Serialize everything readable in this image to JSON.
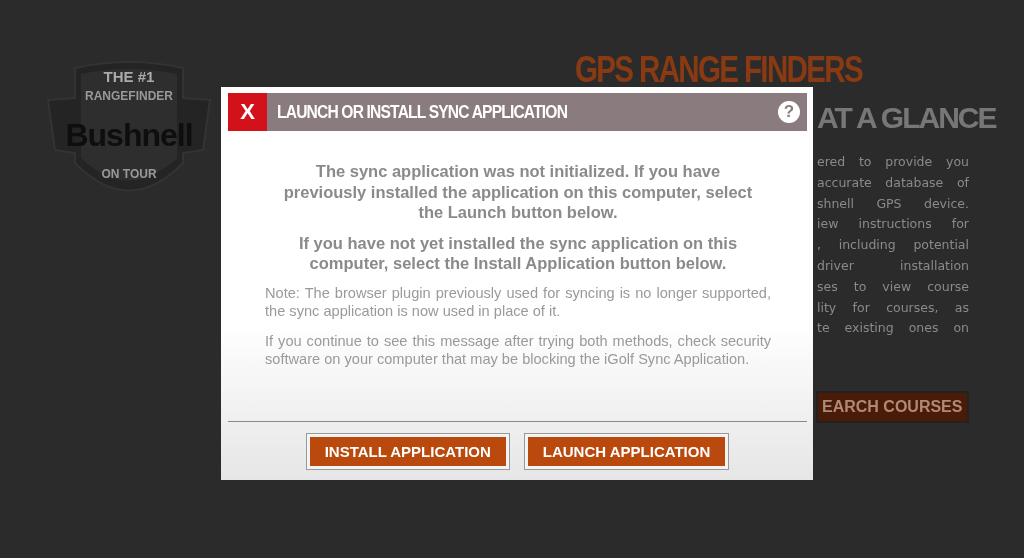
{
  "background_page": {
    "logo": {
      "top_text": "THE #1",
      "arc_text": "RANGEFINDER",
      "brand": "Bushnell",
      "bottom_text": "ON TOUR"
    },
    "heading": "GPS RANGE FINDERS",
    "subheading": "AT A GLANCE",
    "paragraph_lines": [
      "ered to provide you",
      "accurate database of",
      "shnell GPS device.",
      "iew instructions for",
      ", including potential",
      "driver installation",
      "ses to view course",
      "lity for courses, as",
      "te existing ones on"
    ],
    "search_button": "EARCH COURSES"
  },
  "dialog": {
    "close_label": "X",
    "title": "LAUNCH OR INSTALL SYNC APPLICATION",
    "help_label": "?",
    "messages": [
      {
        "kind": "lead",
        "text": "The sync application was not initialized. If you have previously installed the application on this computer, select the Launch button below."
      },
      {
        "kind": "lead",
        "text": "If you have not yet installed the sync application on this computer, select the Install Application button below."
      },
      {
        "kind": "note",
        "text": "Note: The browser plugin previously used for syncing is no longer supported, the sync application is now used in place of it."
      },
      {
        "kind": "note",
        "text": "If you continue to see this message after trying both methods, check security software on your computer that may be blocking the iGolf Sync Application."
      }
    ],
    "buttons": [
      {
        "label": "INSTALL APPLICATION"
      },
      {
        "label": "LAUNCH APPLICATION"
      }
    ]
  }
}
